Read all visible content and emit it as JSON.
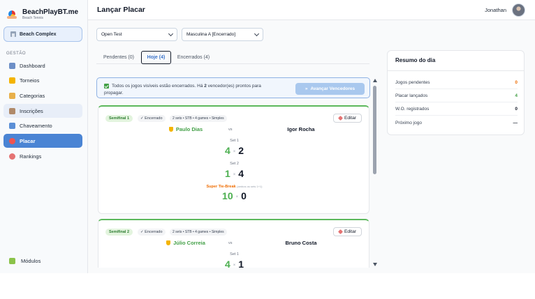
{
  "brand": {
    "name": "BeachPlayBT.me",
    "subtitle": "Beach Tennis"
  },
  "org": {
    "name": "Beach Complex",
    "icon": "building-icon"
  },
  "sidebar": {
    "section": "GESTÃO",
    "items": [
      {
        "label": "Dashboard",
        "icon": "chart-icon",
        "color": "#6d8fc7"
      },
      {
        "label": "Torneios",
        "icon": "trophy-icon",
        "color": "#f4b400"
      },
      {
        "label": "Categorias",
        "icon": "folder-icon",
        "color": "#e8b04a"
      },
      {
        "label": "Inscrições",
        "icon": "clipboard-icon",
        "color": "#b08a6a"
      },
      {
        "label": "Chaveamento",
        "icon": "bracket-icon",
        "color": "#5b8fd6"
      },
      {
        "label": "Placar",
        "icon": "target-icon",
        "color": "#ef5350"
      },
      {
        "label": "Rankings",
        "icon": "medal-icon",
        "color": "#e57373"
      }
    ],
    "modules_label": "Módulos",
    "modules_icon": "puzzle-icon"
  },
  "header": {
    "title": "Lançar Placar",
    "user_name": "Jonathan"
  },
  "filters": {
    "tournament": "Open Test",
    "category": "Masculina A [Encerrado]"
  },
  "tabs": [
    {
      "label": "Pendentes (0)"
    },
    {
      "label": "Hoje (4)"
    },
    {
      "label": "Encerrados (4)"
    }
  ],
  "notice": {
    "text_a": "Todos os jogos visíveis estão encerrados.  Há ",
    "count": "2",
    "text_b": " vencedor(es) prontos para propagar.",
    "button": "Avançar Vencedores"
  },
  "matches": [
    {
      "phase": "Semifinal 1",
      "status": "✓ Encerrado",
      "format": "2 sets • STB • 4 games • Simples",
      "edit_label": "Editar",
      "player1": "Paulo Dias",
      "vs": "vs",
      "player2": "Igor Rocha",
      "sets": [
        {
          "label": "Set 1",
          "p1": "4",
          "p2": "2"
        },
        {
          "label": "Set 2",
          "p1": "1",
          "p2": "4"
        }
      ],
      "stb": {
        "label": "Super Tie-Break",
        "note": "(ambos os sets 1+1)",
        "p1": "10",
        "p2": "0"
      }
    },
    {
      "phase": "Semifinal 2",
      "status": "✓ Encerrado",
      "format": "2 sets • STB • 4 games • Simples",
      "edit_label": "Editar",
      "player1": "Júlio Correia",
      "vs": "vs",
      "player2": "Bruno Costa",
      "sets": [
        {
          "label": "Set 1",
          "p1": "4",
          "p2": "1"
        }
      ]
    }
  ],
  "score_separator": "×",
  "summary": {
    "title": "Resumo do dia",
    "rows": [
      {
        "label": "Jogos pendentes",
        "value": "0",
        "color": "#ef6c00"
      },
      {
        "label": "Placar lançados",
        "value": "4",
        "color": "#43a047"
      },
      {
        "label": "W.O. registrados",
        "value": "0",
        "color": "#111827"
      },
      {
        "label": "Próximo jogo",
        "value": "—",
        "color": "#111827"
      }
    ]
  }
}
